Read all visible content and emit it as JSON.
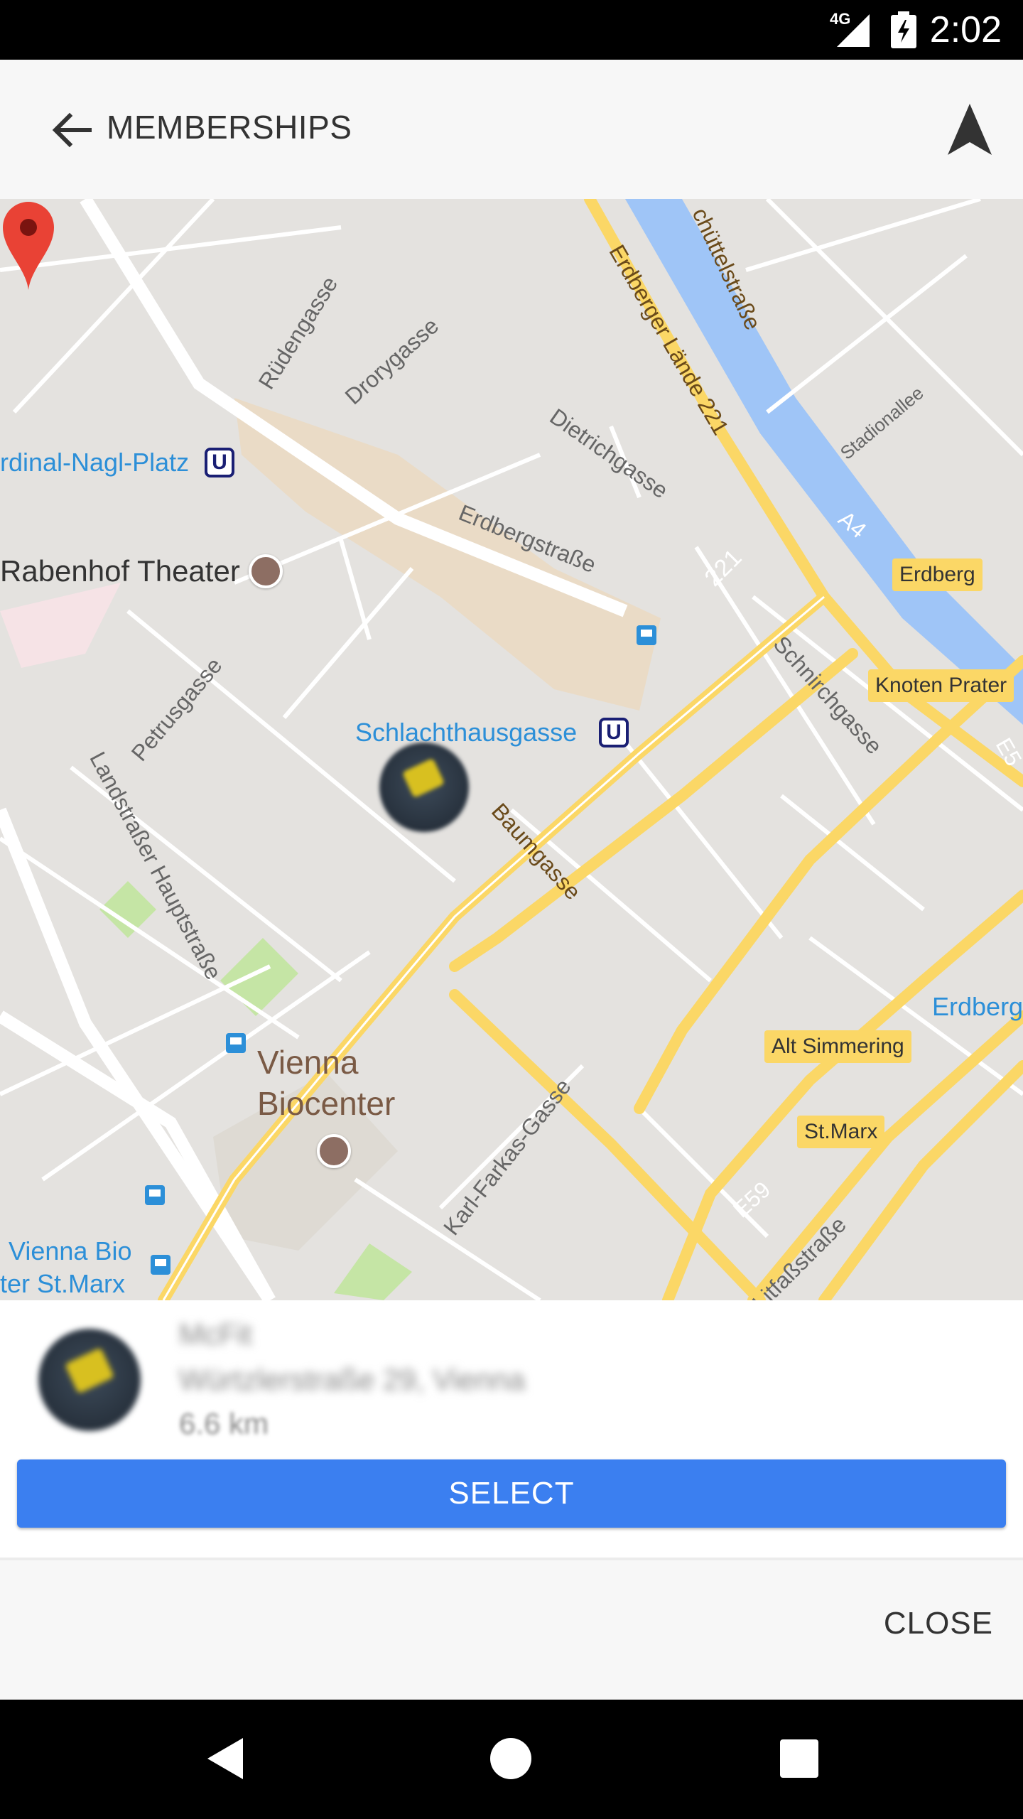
{
  "status_bar": {
    "network": "4G",
    "time": "2:02"
  },
  "app_bar": {
    "title": "MEMBERSHIPS"
  },
  "map": {
    "labels": {
      "rudengasse": "Rüdengasse",
      "drorygasse": "Drorygasse",
      "dietrichgasse": "Dietrichgasse",
      "erdbergstrasse": "Erdbergstraße",
      "erdberger_laende": "Erdberger Lände 221",
      "schuettelstrasse": "chüttelstraße",
      "stadionallee": "Stadionallee",
      "a4": "A4",
      "r221": "221",
      "kardinal": "rdinal-Nagl-Platz",
      "rabenhof": "Rabenhof Theater",
      "schlachthausgasse": "Schlachthausgasse",
      "petrusgasse": "Petrusgasse",
      "landstrasser": "Landstraßer Hauptstraße",
      "baumgasse": "Baumgasse",
      "schnirchgasse": "Schnirchgasse",
      "vienna_biocenter": "Vienna Biocenter",
      "karl_farkas": "Karl-Farkas-Gasse",
      "vienna_bio": "Vienna Bio",
      "ter_st_marx": "ter St.Marx",
      "e59": "E59",
      "litfass": "Litfaßstraße",
      "e5": "E5",
      "erdberg_blue": "Erdberg",
      "u": "U"
    },
    "badges": {
      "erdberg": "Erdberg",
      "knoten_prater": "Knoten Prater",
      "alt_simmering": "Alt Simmering",
      "st_marx": "St.Marx"
    }
  },
  "gym": {
    "name": "McFit",
    "address": "Würtzlerstraße 29, Vienna",
    "distance": "6.6 km"
  },
  "actions": {
    "select_label": "SELECT",
    "close_label": "CLOSE"
  }
}
